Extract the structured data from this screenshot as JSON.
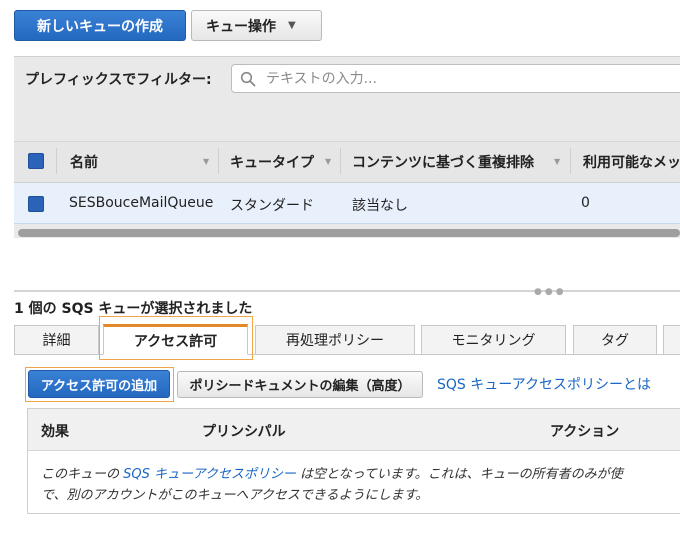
{
  "toolbar": {
    "create_queue_label": "新しいキューの作成",
    "queue_actions_label": "キュー操作"
  },
  "filter": {
    "label": "プレフィックスでフィルター:",
    "placeholder": "テキストの入力..."
  },
  "table": {
    "columns": [
      "名前",
      "キュータイプ",
      "コンテンツに基づく重複排除",
      "利用可能なメッ"
    ],
    "rows": [
      {
        "name": "SESBouceMailQueue",
        "type": "スタンダード",
        "dedup": "該当なし",
        "available": "0"
      }
    ]
  },
  "details": {
    "selected_title": "1 個の SQS キューが選択されました",
    "tabs": [
      "詳細",
      "アクセス許可",
      "再処理ポリシー",
      "モニタリング",
      "タグ"
    ],
    "active_tab": "アクセス許可"
  },
  "permissions": {
    "add_button": "アクセス許可の追加",
    "edit_button": "ポリシードキュメントの編集（高度）",
    "help_link": "SQS キューアクセスポリシーとは",
    "columns": [
      "効果",
      "プリンシパル",
      "アクション"
    ],
    "message_prefix": "このキューの ",
    "message_link": "SQS キューアクセスポリシー",
    "message_mid": " は空となっています。これは、キューの所有者のみが使",
    "message_line2": "で、別のアカウントがこのキューへアクセスできるようにします。"
  },
  "colors": {
    "primary_button": "#2468c0",
    "active_tab_accent": "#e08a2c",
    "highlight_outline": "#f0a54a",
    "link": "#1a66c5",
    "selected_row": "#e8f1fb"
  }
}
